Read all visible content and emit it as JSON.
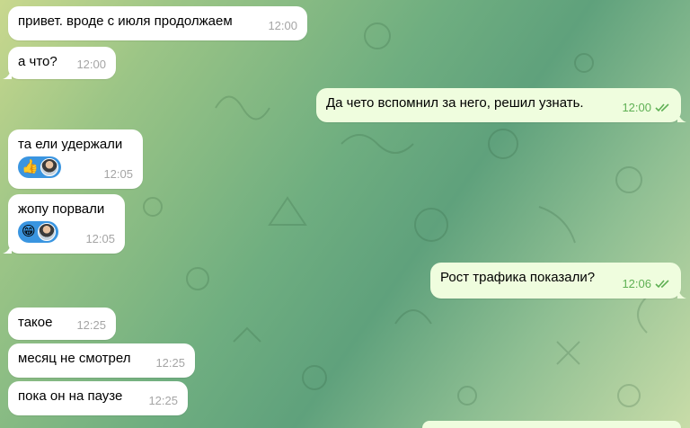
{
  "messages": [
    {
      "text": "привет. вроде с июля продолжаем",
      "time": "12:00"
    },
    {
      "text": "а что?",
      "time": "12:00"
    },
    {
      "text": "Да чето вспомнил за него, решил узнать.",
      "time": "12:00"
    },
    {
      "text": "та ели удержали",
      "time": "12:05",
      "reaction": "👍"
    },
    {
      "text": "жопу порвали",
      "time": "12:05",
      "reaction": "😁"
    },
    {
      "text": "Рост трафика показали?",
      "time": "12:06"
    },
    {
      "text": "такое",
      "time": "12:25"
    },
    {
      "text": "месяц не смотрел",
      "time": "12:25"
    },
    {
      "text": "пока он на паузе",
      "time": "12:25"
    }
  ],
  "colors": {
    "incoming_bubble": "#ffffff",
    "outgoing_bubble": "#effdde",
    "outgoing_time": "#5fb054",
    "reaction_bg": "#3a95e0"
  },
  "icons": {
    "read_receipt": "double-check-icon",
    "reaction_avatar": "avatar"
  }
}
